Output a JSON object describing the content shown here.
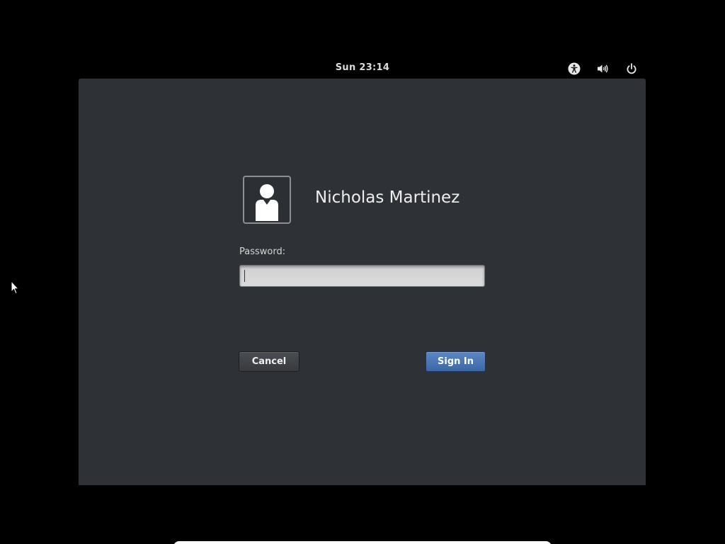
{
  "top_bar": {
    "clock": "Sun 23:14",
    "icons": [
      "accessibility-icon",
      "volume-icon",
      "power-icon"
    ]
  },
  "login_dialog": {
    "user_name": "Nicholas Martinez",
    "avatar_icon": "user-avatar-icon",
    "password_label": "Password:",
    "password_value": "",
    "buttons": {
      "cancel": "Cancel",
      "sign_in": "Sign In"
    }
  },
  "colors": {
    "background": "#000000",
    "dialog": "#2e3136",
    "accent": "#4a77b5",
    "text": "#eeeeec"
  }
}
